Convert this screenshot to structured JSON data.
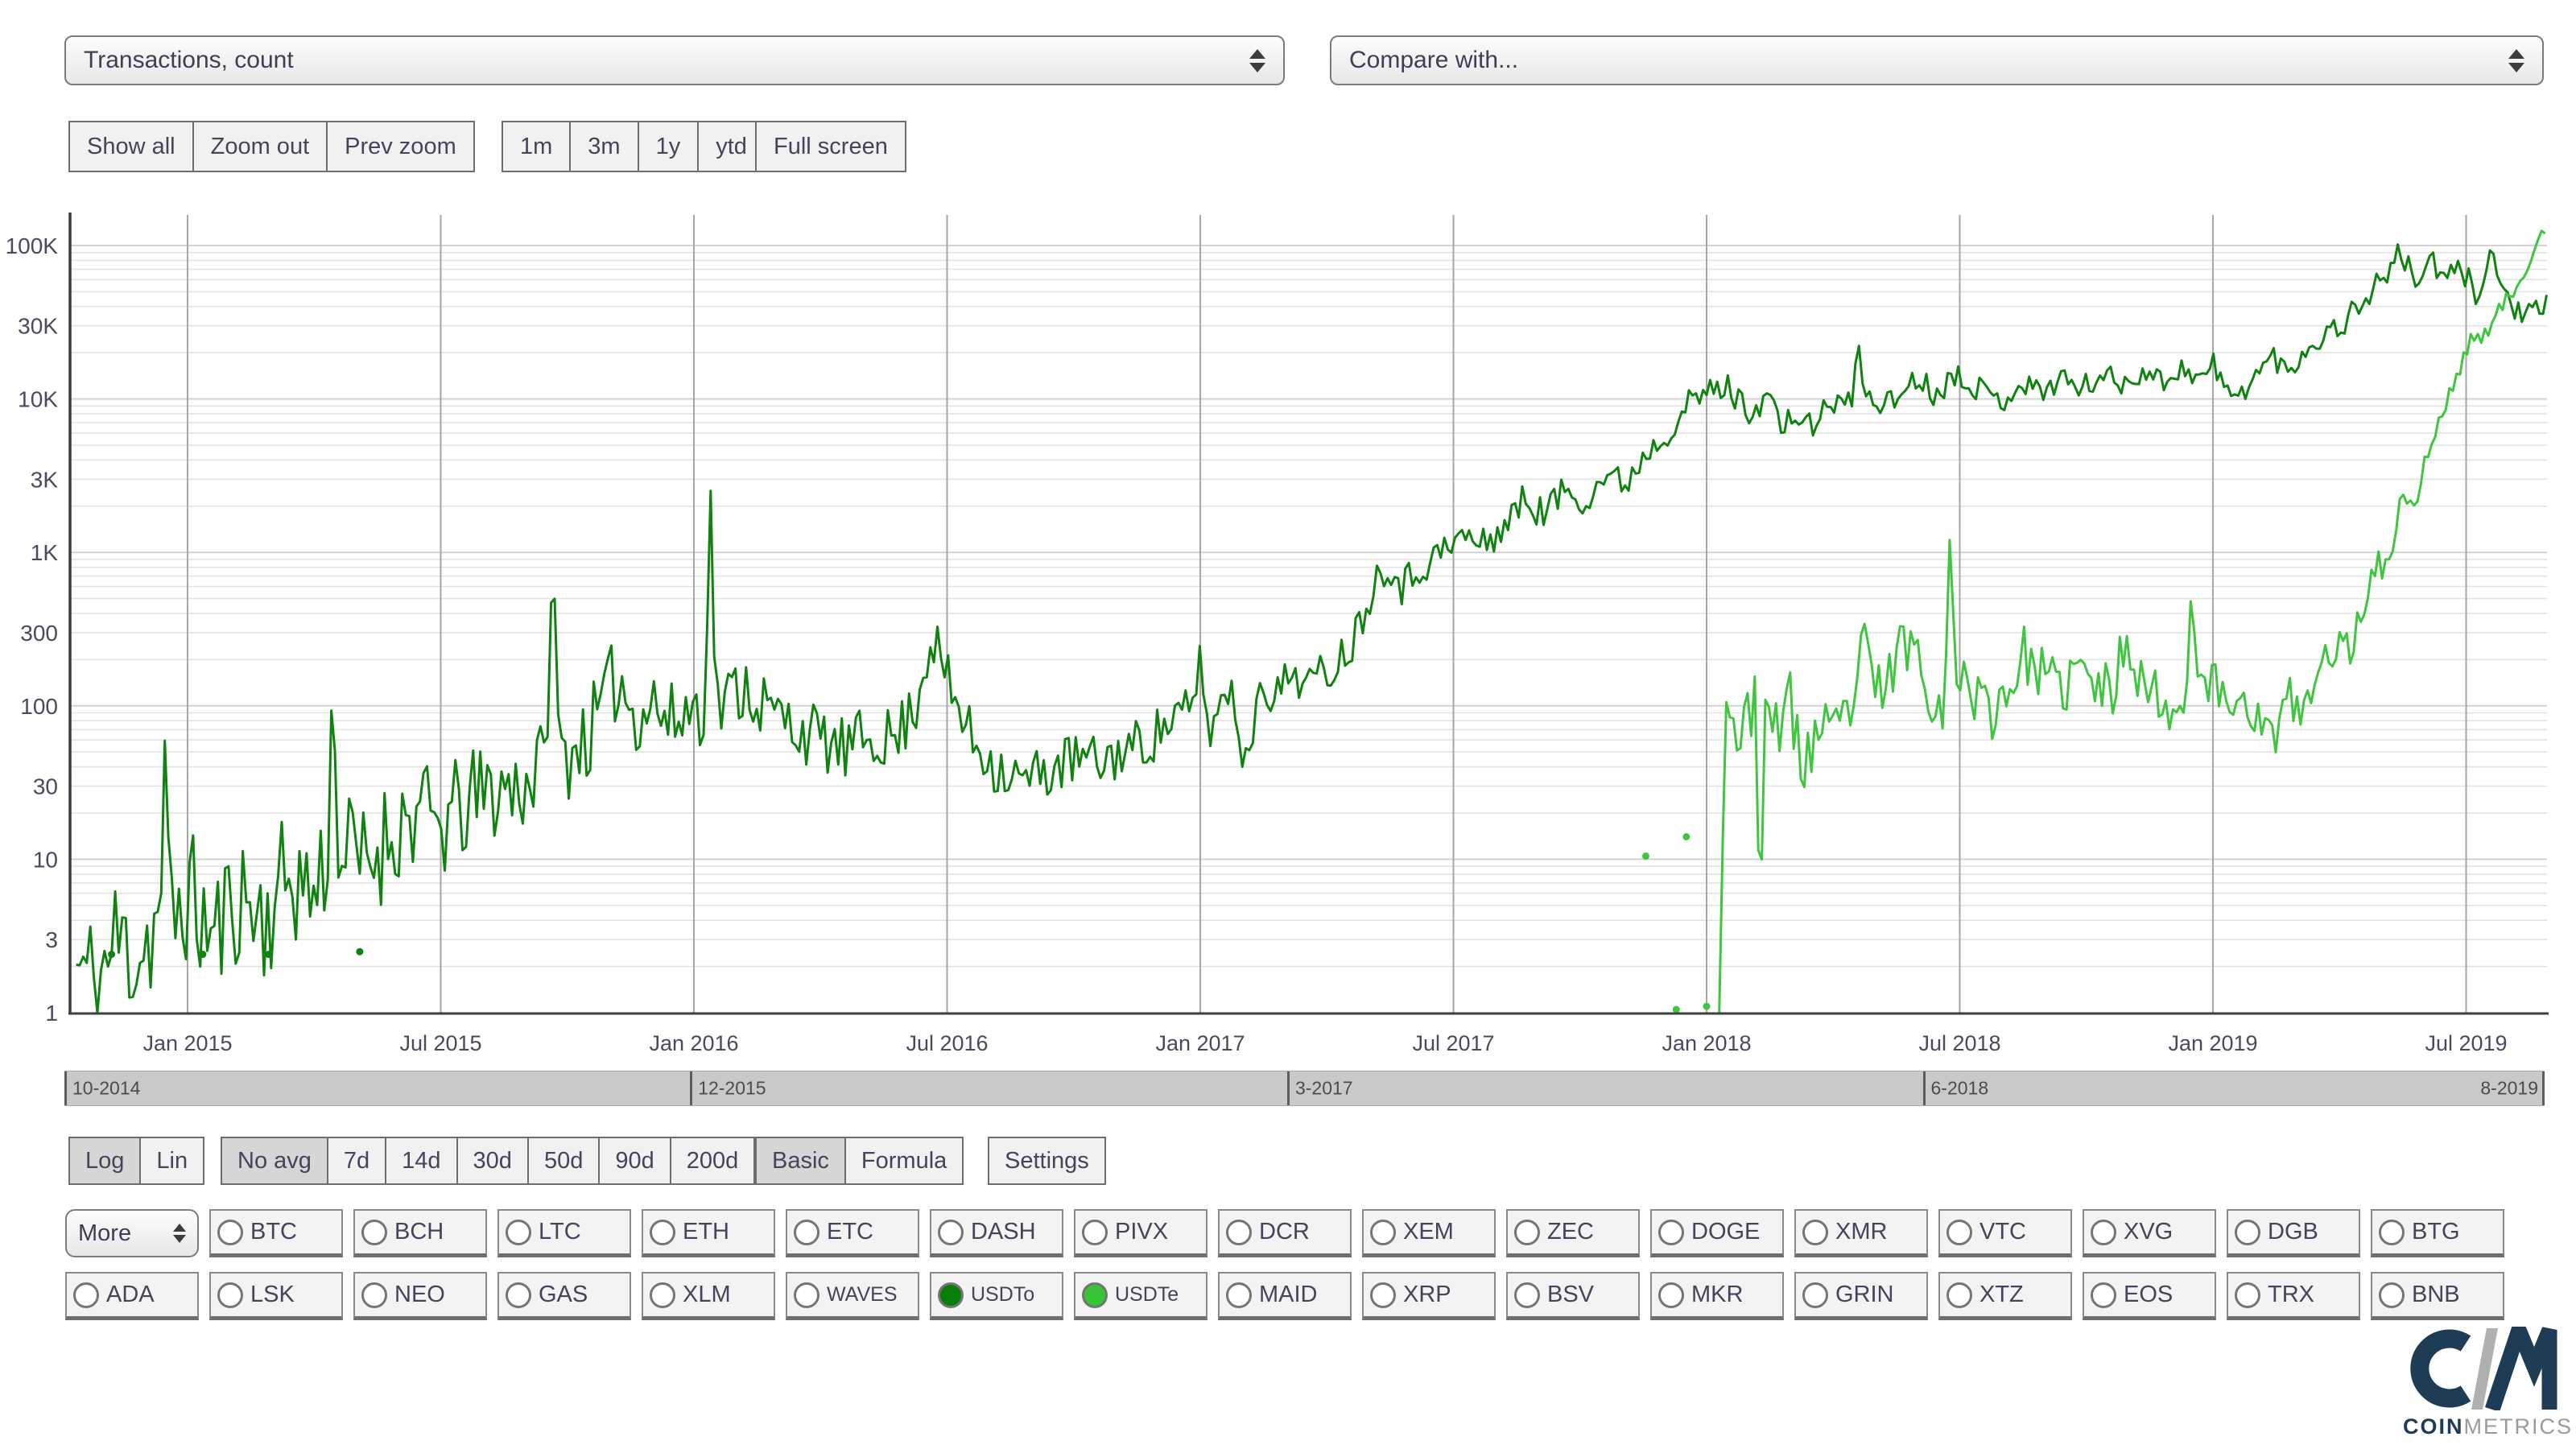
{
  "header": {
    "metric_select_value": "Transactions, count",
    "compare_select_value": "Compare with..."
  },
  "toolbar": {
    "groups": [
      {
        "name": "zoom-controls",
        "buttons": [
          {
            "label": "Show all"
          },
          {
            "label": "Zoom out"
          },
          {
            "label": "Prev zoom"
          }
        ]
      },
      {
        "name": "range-presets",
        "buttons": [
          {
            "label": "1m"
          },
          {
            "label": "3m"
          },
          {
            "label": "1y"
          },
          {
            "label": "ytd"
          }
        ]
      },
      {
        "name": "fullscreen",
        "buttons": [
          {
            "label": "Full screen"
          }
        ]
      }
    ]
  },
  "chart_data": {
    "type": "line",
    "title": "",
    "xlabel": "",
    "ylabel": "",
    "y_scale": "log",
    "ylim": [
      1,
      162000
    ],
    "x_range": [
      2014.77,
      2019.66
    ],
    "grid": true,
    "legend": "none",
    "y_ticks": [
      {
        "label": "100K",
        "value": 100000
      },
      {
        "label": "30K",
        "value": 30000
      },
      {
        "label": "10K",
        "value": 10000
      },
      {
        "label": "3K",
        "value": 3000
      },
      {
        "label": "1K",
        "value": 1000
      },
      {
        "label": "300",
        "value": 300
      },
      {
        "label": "100",
        "value": 100
      },
      {
        "label": "30",
        "value": 30
      },
      {
        "label": "10",
        "value": 10
      },
      {
        "label": "3",
        "value": 3
      },
      {
        "label": "1",
        "value": 1
      }
    ],
    "x_ticks": [
      {
        "label": "Jan 2015",
        "value": 2015.0
      },
      {
        "label": "Jul 2015",
        "value": 2015.5
      },
      {
        "label": "Jan 2016",
        "value": 2016.0
      },
      {
        "label": "Jul 2016",
        "value": 2016.5
      },
      {
        "label": "Jan 2017",
        "value": 2017.0
      },
      {
        "label": "Jul 2017",
        "value": 2017.5
      },
      {
        "label": "Jan 2018",
        "value": 2018.0
      },
      {
        "label": "Jul 2018",
        "value": 2018.5
      },
      {
        "label": "Jan 2019",
        "value": 2019.0
      },
      {
        "label": "Jul 2019",
        "value": 2019.5
      }
    ],
    "series": [
      {
        "name": "USDTo",
        "color": "#0f820f",
        "seed": 11,
        "anchors": [
          [
            2014.78,
            2
          ],
          [
            2014.82,
            1.5
          ],
          [
            2014.86,
            3
          ],
          [
            2014.9,
            2.5
          ],
          [
            2014.945,
            4
          ],
          [
            2014.955,
            28
          ],
          [
            2014.965,
            4
          ],
          [
            2015.0,
            6
          ],
          [
            2015.05,
            3
          ],
          [
            2015.1,
            6
          ],
          [
            2015.15,
            4
          ],
          [
            2015.2,
            8
          ],
          [
            2015.25,
            6
          ],
          [
            2015.275,
            10
          ],
          [
            2015.285,
            90
          ],
          [
            2015.3,
            12
          ],
          [
            2015.35,
            9
          ],
          [
            2015.4,
            15
          ],
          [
            2015.45,
            20
          ],
          [
            2015.5,
            16
          ],
          [
            2015.55,
            22
          ],
          [
            2015.6,
            28
          ],
          [
            2015.65,
            30
          ],
          [
            2015.705,
            40
          ],
          [
            2015.72,
            770
          ],
          [
            2015.735,
            45
          ],
          [
            2015.8,
            70
          ],
          [
            2015.85,
            160
          ],
          [
            2015.88,
            90
          ],
          [
            2015.92,
            110
          ],
          [
            2015.95,
            75
          ],
          [
            2016.0,
            100
          ],
          [
            2016.02,
            100
          ],
          [
            2016.032,
            2200
          ],
          [
            2016.045,
            95
          ],
          [
            2016.1,
            140
          ],
          [
            2016.15,
            90
          ],
          [
            2016.2,
            75
          ],
          [
            2016.25,
            60
          ],
          [
            2016.3,
            50
          ],
          [
            2016.35,
            65
          ],
          [
            2016.4,
            60
          ],
          [
            2016.44,
            110
          ],
          [
            2016.47,
            300
          ],
          [
            2016.5,
            140
          ],
          [
            2016.55,
            60
          ],
          [
            2016.6,
            40
          ],
          [
            2016.65,
            32
          ],
          [
            2016.7,
            38
          ],
          [
            2016.75,
            45
          ],
          [
            2016.8,
            42
          ],
          [
            2016.85,
            52
          ],
          [
            2016.9,
            60
          ],
          [
            2016.95,
            85
          ],
          [
            2016.99,
            90
          ],
          [
            2017.0,
            300
          ],
          [
            2017.012,
            65
          ],
          [
            2017.06,
            140
          ],
          [
            2017.09,
            40
          ],
          [
            2017.12,
            160
          ],
          [
            2017.15,
            110
          ],
          [
            2017.18,
            170
          ],
          [
            2017.22,
            140
          ],
          [
            2017.26,
            180
          ],
          [
            2017.3,
            260
          ],
          [
            2017.34,
            600
          ],
          [
            2017.37,
            900
          ],
          [
            2017.4,
            600
          ],
          [
            2017.44,
            850
          ],
          [
            2017.48,
            1000
          ],
          [
            2017.52,
            1300
          ],
          [
            2017.56,
            1100
          ],
          [
            2017.6,
            1500
          ],
          [
            2017.64,
            2200
          ],
          [
            2017.68,
            1800
          ],
          [
            2017.72,
            2600
          ],
          [
            2017.76,
            2200
          ],
          [
            2017.8,
            3200
          ],
          [
            2017.84,
            2800
          ],
          [
            2017.88,
            4500
          ],
          [
            2017.92,
            6000
          ],
          [
            2017.96,
            9000
          ],
          [
            2018.0,
            11000
          ],
          [
            2018.04,
            12000
          ],
          [
            2018.08,
            8500
          ],
          [
            2018.12,
            10000
          ],
          [
            2018.14,
            9500
          ],
          [
            2018.15,
            3800
          ],
          [
            2018.162,
            8500
          ],
          [
            2018.2,
            6500
          ],
          [
            2018.26,
            10000
          ],
          [
            2018.29,
            9000
          ],
          [
            2018.3,
            28000
          ],
          [
            2018.312,
            10000
          ],
          [
            2018.37,
            9500
          ],
          [
            2018.41,
            14000
          ],
          [
            2018.45,
            11000
          ],
          [
            2018.5,
            15000
          ],
          [
            2018.54,
            11500
          ],
          [
            2018.58,
            9500
          ],
          [
            2018.62,
            13000
          ],
          [
            2018.66,
            11000
          ],
          [
            2018.7,
            14000
          ],
          [
            2018.74,
            11500
          ],
          [
            2018.78,
            14500
          ],
          [
            2018.82,
            12500
          ],
          [
            2018.86,
            15500
          ],
          [
            2018.9,
            13000
          ],
          [
            2018.94,
            16000
          ],
          [
            2018.98,
            13500
          ],
          [
            2019.0,
            17000
          ],
          [
            2019.04,
            9500
          ],
          [
            2019.08,
            14000
          ],
          [
            2019.12,
            19000
          ],
          [
            2019.15,
            14500
          ],
          [
            2019.18,
            21000
          ],
          [
            2019.22,
            26000
          ],
          [
            2019.26,
            32000
          ],
          [
            2019.3,
            45000
          ],
          [
            2019.34,
            65000
          ],
          [
            2019.37,
            88000
          ],
          [
            2019.4,
            60000
          ],
          [
            2019.43,
            78000
          ],
          [
            2019.46,
            58000
          ],
          [
            2019.49,
            72000
          ],
          [
            2019.52,
            48000
          ],
          [
            2019.55,
            92000
          ],
          [
            2019.57,
            52000
          ],
          [
            2019.6,
            38000
          ],
          [
            2019.63,
            34000
          ],
          [
            2019.66,
            40000
          ]
        ],
        "noise": [
          [
            2014.78,
            0.5
          ],
          [
            2015.3,
            0.42
          ],
          [
            2015.8,
            0.3
          ],
          [
            2016.2,
            0.22
          ],
          [
            2016.8,
            0.18
          ],
          [
            2017.3,
            0.14
          ],
          [
            2017.8,
            0.1
          ],
          [
            2018.3,
            0.09
          ],
          [
            2019.0,
            0.08
          ],
          [
            2019.66,
            0.09
          ]
        ],
        "dots": [
          [
            2014.85,
            2.4
          ],
          [
            2015.03,
            2.4
          ],
          [
            2015.16,
            2.4
          ],
          [
            2015.34,
            2.5
          ]
        ]
      },
      {
        "name": "USDTe",
        "color": "#3fc53f",
        "seed": 23,
        "anchors": [
          [
            2018.025,
            1.4
          ],
          [
            2018.035,
            80
          ],
          [
            2018.05,
            120
          ],
          [
            2018.07,
            45
          ],
          [
            2018.09,
            130
          ],
          [
            2018.095,
            120
          ],
          [
            2018.105,
            7
          ],
          [
            2018.115,
            60
          ],
          [
            2018.13,
            70
          ],
          [
            2018.16,
            110
          ],
          [
            2018.19,
            40
          ],
          [
            2018.22,
            70
          ],
          [
            2018.25,
            55
          ],
          [
            2018.28,
            90
          ],
          [
            2018.31,
            220
          ],
          [
            2018.34,
            120
          ],
          [
            2018.37,
            180
          ],
          [
            2018.4,
            300
          ],
          [
            2018.43,
            160
          ],
          [
            2018.46,
            100
          ],
          [
            2018.47,
            110
          ],
          [
            2018.48,
            800
          ],
          [
            2018.492,
            190
          ],
          [
            2018.53,
            120
          ],
          [
            2018.56,
            90
          ],
          [
            2018.6,
            140
          ],
          [
            2018.63,
            220
          ],
          [
            2018.66,
            160
          ],
          [
            2018.7,
            120
          ],
          [
            2018.73,
            180
          ],
          [
            2018.76,
            140
          ],
          [
            2018.8,
            120
          ],
          [
            2018.83,
            300
          ],
          [
            2018.86,
            140
          ],
          [
            2018.9,
            110
          ],
          [
            2018.93,
            90
          ],
          [
            2018.945,
            95
          ],
          [
            2018.955,
            750
          ],
          [
            2018.967,
            170
          ],
          [
            2019.0,
            140
          ],
          [
            2019.03,
            100
          ],
          [
            2019.06,
            120
          ],
          [
            2019.09,
            80
          ],
          [
            2019.12,
            60
          ],
          [
            2019.15,
            110
          ],
          [
            2019.18,
            90
          ],
          [
            2019.21,
            160
          ],
          [
            2019.24,
            260
          ],
          [
            2019.27,
            220
          ],
          [
            2019.3,
            500
          ],
          [
            2019.32,
            900
          ],
          [
            2019.34,
            700
          ],
          [
            2019.36,
            1500
          ],
          [
            2019.38,
            2500
          ],
          [
            2019.4,
            2000
          ],
          [
            2019.42,
            4000
          ],
          [
            2019.44,
            6000
          ],
          [
            2019.46,
            9000
          ],
          [
            2019.48,
            14000
          ],
          [
            2019.5,
            20000
          ],
          [
            2019.52,
            28000
          ],
          [
            2019.54,
            25000
          ],
          [
            2019.56,
            35000
          ],
          [
            2019.58,
            45000
          ],
          [
            2019.6,
            55000
          ],
          [
            2019.62,
            75000
          ],
          [
            2019.64,
            100000
          ],
          [
            2019.66,
            135000
          ]
        ],
        "noise": [
          [
            2018.025,
            0.28
          ],
          [
            2018.5,
            0.2
          ],
          [
            2019.0,
            0.18
          ],
          [
            2019.3,
            0.12
          ],
          [
            2019.45,
            0.07
          ],
          [
            2019.66,
            0.04
          ]
        ],
        "dots": [
          [
            2017.88,
            10.5
          ],
          [
            2017.96,
            14
          ],
          [
            2017.94,
            1.05
          ],
          [
            2018.0,
            1.1
          ]
        ]
      }
    ]
  },
  "navigator": {
    "segments": [
      {
        "label": "10-2014",
        "frac": 0.0
      },
      {
        "label": "12-2015",
        "frac": 0.2525
      },
      {
        "label": "3-2017",
        "frac": 0.4935
      },
      {
        "label": "6-2018",
        "frac": 0.75
      }
    ],
    "end_label": "8-2019"
  },
  "controls": {
    "groups": [
      {
        "name": "scale",
        "buttons": [
          {
            "label": "Log",
            "active": true
          },
          {
            "label": "Lin"
          }
        ]
      },
      {
        "name": "averaging",
        "buttons": [
          {
            "label": "No avg",
            "active": true
          },
          {
            "label": "7d"
          },
          {
            "label": "14d"
          },
          {
            "label": "30d"
          },
          {
            "label": "50d"
          },
          {
            "label": "90d"
          },
          {
            "label": "200d"
          }
        ]
      },
      {
        "name": "mode",
        "buttons": [
          {
            "label": "Basic",
            "active": true
          },
          {
            "label": "Formula"
          }
        ]
      },
      {
        "name": "settings",
        "buttons": [
          {
            "label": "Settings"
          }
        ]
      }
    ]
  },
  "coins": {
    "more_label": "More",
    "row1": [
      {
        "label": "BTC"
      },
      {
        "label": "BCH"
      },
      {
        "label": "LTC"
      },
      {
        "label": "ETH"
      },
      {
        "label": "ETC"
      },
      {
        "label": "DASH"
      },
      {
        "label": "PIVX"
      },
      {
        "label": "DCR"
      },
      {
        "label": "XEM"
      },
      {
        "label": "ZEC"
      },
      {
        "label": "DOGE"
      },
      {
        "label": "XMR"
      },
      {
        "label": "VTC"
      },
      {
        "label": "XVG"
      },
      {
        "label": "DGB"
      },
      {
        "label": "BTG"
      }
    ],
    "row2": [
      {
        "label": "ADA"
      },
      {
        "label": "LSK"
      },
      {
        "label": "NEO"
      },
      {
        "label": "GAS"
      },
      {
        "label": "XLM"
      },
      {
        "label": "WAVES",
        "small": true
      },
      {
        "label": "USDTo",
        "small": true,
        "selected": true,
        "color": "#087f08"
      },
      {
        "label": "USDTe",
        "small": true,
        "selected": true,
        "color": "#35c435"
      },
      {
        "label": "MAID"
      },
      {
        "label": "XRP"
      },
      {
        "label": "BSV"
      },
      {
        "label": "MKR"
      },
      {
        "label": "GRIN"
      },
      {
        "label": "XTZ"
      },
      {
        "label": "EOS"
      },
      {
        "label": "TRX"
      },
      {
        "label": "BNB"
      }
    ]
  },
  "logo": {
    "coin": "COIN",
    "metrics": "METRICS"
  }
}
